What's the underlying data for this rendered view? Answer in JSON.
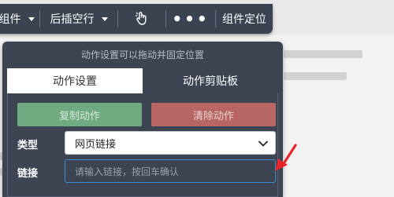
{
  "toolbar": {
    "components_label": "组件",
    "insert_label": "后插空行",
    "component_locate_label": "组件定位",
    "more_icon": "more-dots-icon",
    "cursor_icon": "pointer-click-icon"
  },
  "panel": {
    "header_text": "动作设置可以拖动并固定位置",
    "tabs": [
      {
        "label": "动作设置",
        "active": true
      },
      {
        "label": "动作剪贴板",
        "active": false
      }
    ],
    "copy_button": "复制动作",
    "clear_button": "清除动作",
    "type_label": "类型",
    "type_value": "网页链接",
    "link_label": "链接",
    "link_placeholder": "请输入链接，按回车确认"
  },
  "colors": {
    "toolbar_bg": "#3b4351",
    "panel_bg": "#3d4452",
    "copy_button_bg": "#6faa80",
    "clear_button_bg": "#b76663",
    "input_border": "#3a8fd4",
    "annotation_arrow": "#e8262a"
  }
}
